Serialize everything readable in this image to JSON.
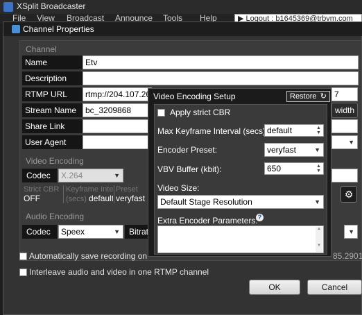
{
  "app": {
    "title": "XSplit Broadcaster",
    "menu": [
      "File",
      "View",
      "Broadcast",
      "Announce",
      "Tools",
      "Help"
    ],
    "logout_label": "Logout : b1645369@trbvm.com"
  },
  "dialog": {
    "title": "Channel Properties",
    "section_channel": "Channel",
    "fields": [
      {
        "label": "Name",
        "value": "Etv"
      },
      {
        "label": "Description",
        "value": ""
      },
      {
        "label": "RTMP URL",
        "value": "rtmp://204.107.26.7"
      },
      {
        "label": "Stream Name",
        "value": "bc_3209868"
      },
      {
        "label": "Share Link",
        "value": ""
      },
      {
        "label": "User Agent",
        "value": ""
      }
    ],
    "bandwidth_button": "width",
    "stream_name_tail": "7",
    "section_video": "Video Encoding",
    "codec_label": "Codec",
    "video_codec": "X.264",
    "info": {
      "strict_cbr_head": "Strict CBR",
      "strict_cbr_val": "OFF",
      "keyframe_head": "Keyframe Inte",
      "keyframe_sub": "(secs)",
      "keyframe_val": "default",
      "preset_head": "Preset",
      "preset_val": "veryfast"
    },
    "section_audio": "Audio Encoding",
    "audio_codec": "Speex",
    "bitrate_label": "Bitrat",
    "audio_tail": "85.2901",
    "autosave_label": "Automatically save recording on lo",
    "interleave_label": "Interleave audio and video in one RTMP channel",
    "ok_button": "OK",
    "cancel_button": "Cancel"
  },
  "video_setup": {
    "title": "Video Encoding Setup",
    "restore_button": "Restore",
    "apply_cbr_label": "Apply strict CBR",
    "keyframe_label": "Max Keyframe Interval (secs):",
    "keyframe_value": "default",
    "preset_label": "Encoder Preset:",
    "preset_value": "veryfast",
    "vbv_label": "VBV Buffer (kbit):",
    "vbv_value": "650",
    "video_size_label": "Video Size:",
    "video_size_value": "Default Stage Resolution",
    "extra_label": "Extra Encoder Parameters:",
    "extra_value": ""
  }
}
